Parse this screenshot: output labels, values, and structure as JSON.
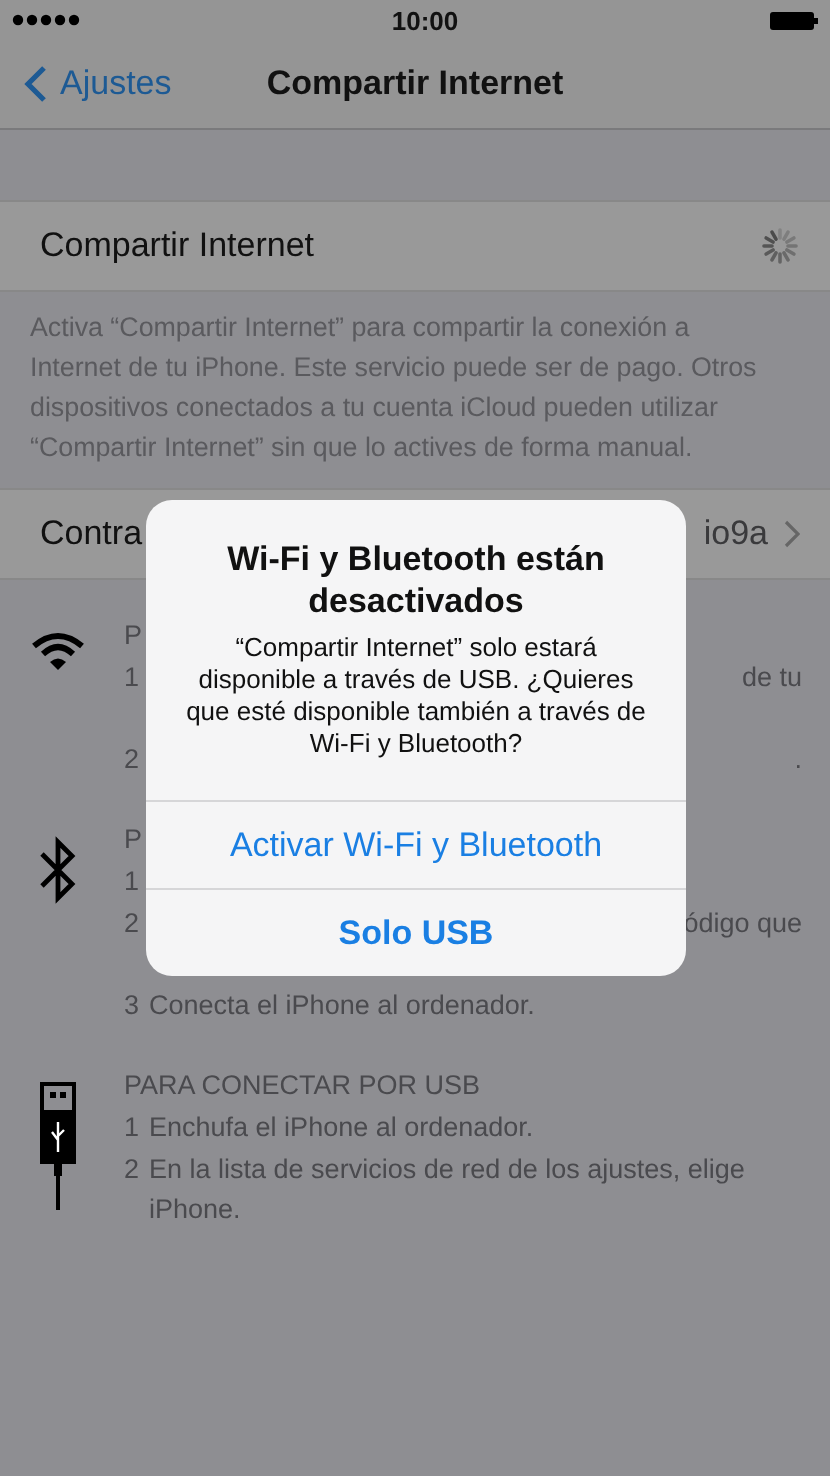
{
  "status_bar": {
    "time": "10:00"
  },
  "nav": {
    "back": "Ajustes",
    "title": "Compartir Internet"
  },
  "hotspot_row": {
    "label": "Compartir Internet"
  },
  "footer": "Activa “Compartir Internet” para compartir la conexión a Internet de tu iPhone. Este servicio puede ser de pago. Otros dispositivos conectados a tu cuenta iCloud pueden utilizar “Compartir Internet” sin que lo actives de forma manual.",
  "password_row": {
    "label": "Contra",
    "value": "io9a"
  },
  "sections": [
    {
      "kind": "wifi",
      "title": "P",
      "steps": [
        {
          "number": "1",
          "right": "de tu"
        },
        {
          "number": "2",
          "right": "."
        }
      ]
    },
    {
      "kind": "bluetooth",
      "title": "P",
      "steps": [
        {
          "number": "1"
        },
        {
          "number": "2",
          "right": "ódigo que"
        },
        {
          "number": "3",
          "text": "Conecta el iPhone al ordenador."
        }
      ]
    },
    {
      "kind": "usb",
      "title": "PARA CONECTAR POR USB",
      "steps": [
        {
          "number": "1",
          "text": "Enchufa el iPhone al ordenador."
        },
        {
          "number": "2",
          "text": "En la lista de servicios de red de los ajustes, elige iPhone."
        }
      ]
    }
  ],
  "alert": {
    "title": "Wi-Fi y Bluetooth están desactivados",
    "message": "“Compartir Internet” solo estará disponible a través de USB. ¿Quieres que esté disponible también a través de Wi-Fi y Bluetooth?",
    "buttons": [
      {
        "label": "Activar Wi-Fi y Bluetooth",
        "bold": false
      },
      {
        "label": "Solo USB",
        "bold": true
      }
    ]
  }
}
